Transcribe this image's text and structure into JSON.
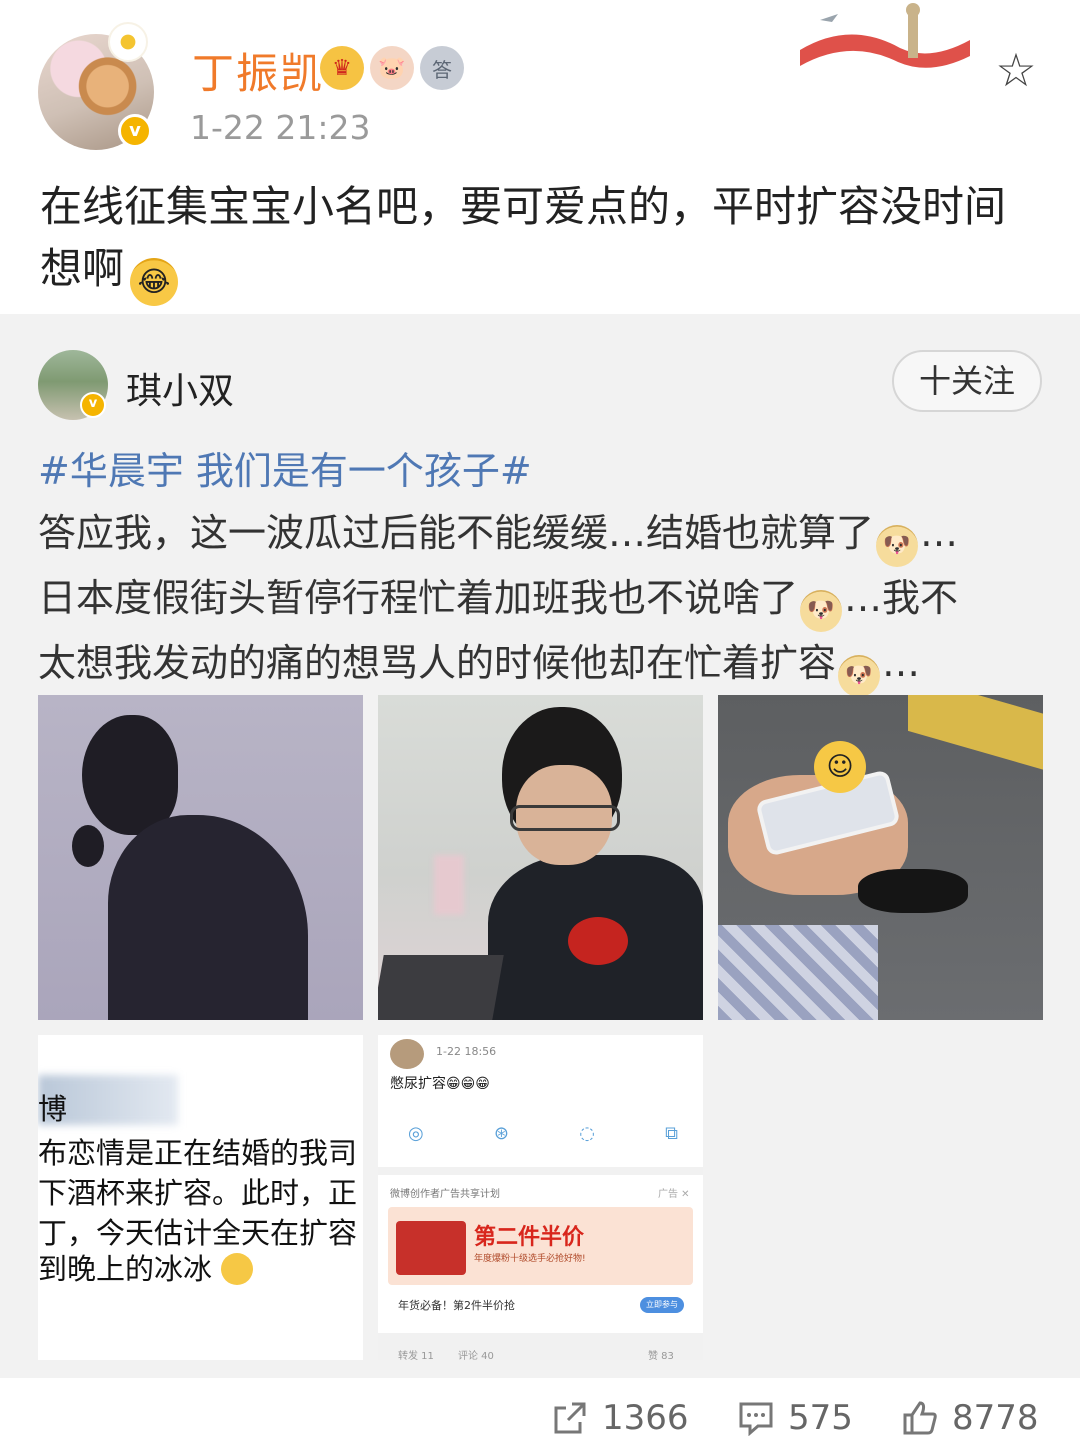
{
  "post": {
    "username": "丁振凯",
    "timestamp": "1-22 21:23",
    "text": "在线征集宝宝小名吧，要可爱点的，平时扩容没时间想啊",
    "badges": [
      {
        "icon": "crown-icon",
        "glyph": "♛"
      },
      {
        "icon": "pig-face-icon",
        "glyph": "🐷"
      },
      {
        "icon": "medal-icon",
        "glyph": "答"
      }
    ],
    "verified_glyph": "v",
    "laugh_emoji": "😂",
    "star_glyph": "☆"
  },
  "repost": {
    "username": "琪小双",
    "follow_label": "十关注",
    "hashtag": "#华晨宇 我们是有一个孩子#",
    "line1": "答应我，这一波瓜过后能不能缓缓…结婚也就算了",
    "line1_end": "…",
    "line2": "日本度假街头暂停行程忙着加班我也不说啥了",
    "line2_end": "…我不",
    "line3": "太想我发动的痛的想骂人的时候他却在忙着扩容",
    "line3_end": "…",
    "dog_glyph": "🐶",
    "image_4": {
      "blur_char": "博",
      "lines": [
        "布恋情是正在结婚的我司",
        "下酒杯来扩容。此时，正",
        "丁，今天估计全天在扩容",
        "到晚上的冰冰"
      ]
    },
    "image_5": {
      "time": "1-22 18:56",
      "text": "憋尿扩容😁😁😁",
      "icons": [
        "◎",
        "⊛",
        "◌",
        "⧉"
      ],
      "ad_label": "微博创作者广告共享计划",
      "ad_tag": "广告 ✕",
      "banner_title": "第二件半价",
      "banner_sub": "年度爆粉十级选手必抢好物!",
      "caption": "年货必备！第2件半价抢",
      "cta": "立即参与",
      "bottom": [
        "转发 11",
        "评论 40",
        "赞 83"
      ]
    }
  },
  "actions": {
    "share_count": "1366",
    "comment_count": "575",
    "like_count": "8778"
  }
}
